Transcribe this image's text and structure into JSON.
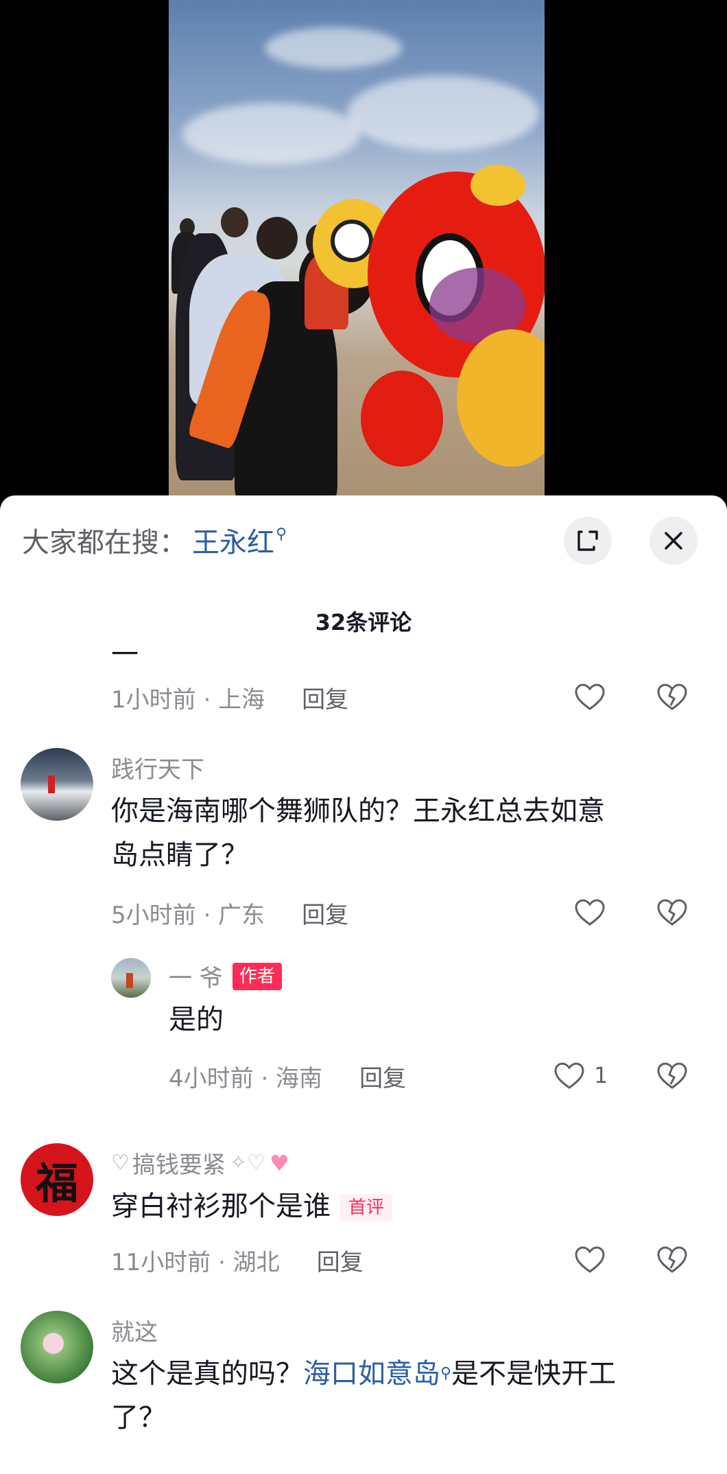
{
  "search": {
    "prefix": "大家都在搜：",
    "keyword": "王永红"
  },
  "comments_title": "32条评论",
  "comments": [
    {
      "meta": "1小时前 · 上海",
      "reply": "回复"
    },
    {
      "user": "践行天下",
      "text": "你是海南哪个舞狮队的？王永红总去如意岛点睛了？",
      "text_line1": "你是海南哪个舞狮队的？王永红总去如意",
      "text_line2": "岛点睛了？",
      "meta": "5小时前 · 广东",
      "reply": "回复"
    },
    {
      "user": "一 爷",
      "badge": "作者",
      "text": "是的",
      "meta": "4小时前 · 海南",
      "reply": "回复",
      "likes": "1"
    },
    {
      "user": "搞钱要紧",
      "text": "穿白衬衫那个是谁",
      "badge": "首评",
      "meta": "11小时前 · 湖北",
      "reply": "回复"
    },
    {
      "user": "就这",
      "text_a": "这个是真的吗？",
      "keyword": "海口如意岛",
      "text_b": "是不是快开工",
      "text_c": "了？"
    }
  ],
  "colors": {
    "accent": "#fe2c55",
    "link": "#2b5ea6",
    "muted": "#8a8b91"
  }
}
